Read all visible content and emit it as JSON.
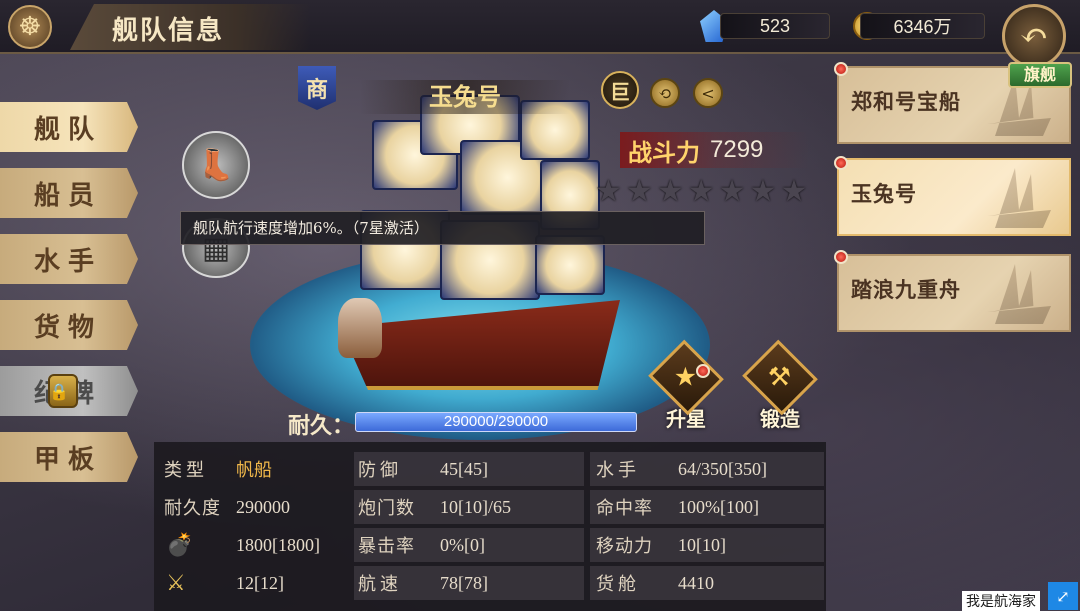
{
  "header": {
    "title": "舰队信息",
    "gems": "523",
    "gold": "6346万"
  },
  "nav": {
    "items": [
      {
        "label": "舰队",
        "active": true
      },
      {
        "label": "船员"
      },
      {
        "label": "水手"
      },
      {
        "label": "货物"
      },
      {
        "label": "纪碑",
        "locked": true
      },
      {
        "label": "甲板"
      }
    ]
  },
  "ship": {
    "type_badge": "商",
    "name": "玉兔号",
    "size_badge": "巨",
    "power_label": "战斗力",
    "power_value": "7299",
    "stars_total": 7,
    "stars_lit": 0,
    "tooltip": "舰队航行速度增加6%。（7星激活）",
    "durability_label": "耐久：",
    "durability_value": "290000/290000",
    "durability_fraction": 1.0
  },
  "actions": {
    "star_up": "升星",
    "forge": "锻造"
  },
  "stats": {
    "rows": [
      [
        {
          "key": "类型",
          "value": "帆船",
          "highlight": true
        },
        {
          "key": "防御",
          "value": "45[45]"
        },
        {
          "key": "水手",
          "value": "64/350[350]"
        }
      ],
      [
        {
          "key": "耐久度",
          "value": "290000"
        },
        {
          "key": "炮门数",
          "value": "10[10]/65"
        },
        {
          "key": "命中率",
          "value": "100%[100]"
        }
      ],
      [
        {
          "icon": "cannon-icon",
          "value": "1800[1800]"
        },
        {
          "key": "暴击率",
          "value": "0%[0]"
        },
        {
          "key": "移动力",
          "value": "10[10]"
        }
      ],
      [
        {
          "icon": "crossed-swords-icon",
          "value": "12[12]"
        },
        {
          "key": "航速",
          "value": "78[78]"
        },
        {
          "key": "货舱",
          "value": "4410"
        }
      ]
    ]
  },
  "fleet": {
    "flagship_tag": "旗舰",
    "ships": [
      {
        "name": "郑和号宝船",
        "selected": false
      },
      {
        "name": "玉兔号",
        "selected": true
      },
      {
        "name": "踏浪九重舟",
        "selected": false
      }
    ]
  },
  "watermark": "我是航海家",
  "colors": {
    "accent_gold": "#f1b84a",
    "power_red": "#821414",
    "durability_blue": "#3d6ad8"
  }
}
